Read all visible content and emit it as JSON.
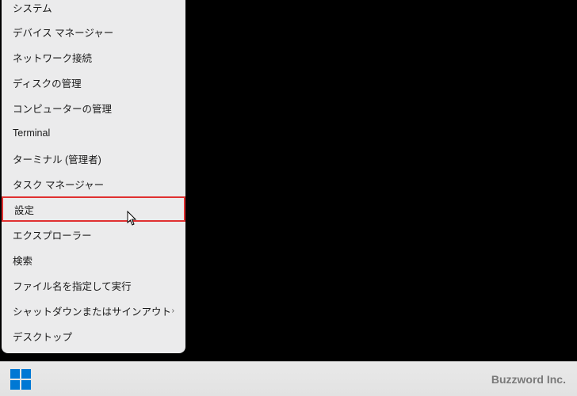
{
  "menu": {
    "items": [
      {
        "label": "システム",
        "hasSubmenu": false
      },
      {
        "label": "デバイス マネージャー",
        "hasSubmenu": false
      },
      {
        "label": "ネットワーク接続",
        "hasSubmenu": false
      },
      {
        "label": "ディスクの管理",
        "hasSubmenu": false
      },
      {
        "label": "コンピューターの管理",
        "hasSubmenu": false
      },
      {
        "label": "Terminal",
        "hasSubmenu": false
      },
      {
        "label": "ターミナル (管理者)",
        "hasSubmenu": false
      },
      {
        "label": "タスク マネージャー",
        "hasSubmenu": false
      },
      {
        "label": "設定",
        "hasSubmenu": false,
        "highlighted": true
      },
      {
        "label": "エクスプローラー",
        "hasSubmenu": false
      },
      {
        "label": "検索",
        "hasSubmenu": false
      },
      {
        "label": "ファイル名を指定して実行",
        "hasSubmenu": false
      },
      {
        "label": "シャットダウンまたはサインアウト",
        "hasSubmenu": true
      },
      {
        "label": "デスクトップ",
        "hasSubmenu": false
      }
    ]
  },
  "chevron": "›",
  "taskbar": {
    "watermark": "Buzzword Inc."
  }
}
